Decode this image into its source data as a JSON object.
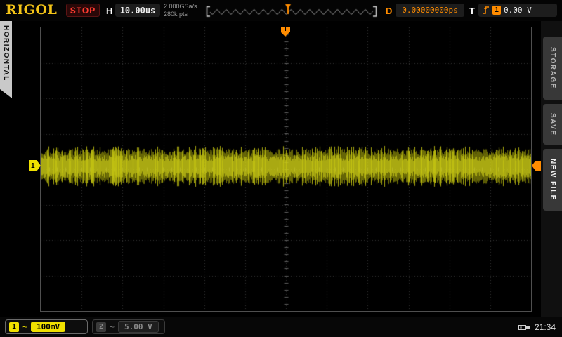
{
  "brand": "RIGOL",
  "status": "STOP",
  "colors": {
    "brand_yellow": "#f5c518",
    "ch1_yellow": "#f0e000",
    "trigger_orange": "#ff8c00",
    "stop_red": "#ff3b30",
    "grid_gray": "#343434",
    "trace_yellow": "#d8d800"
  },
  "horizontal": {
    "label": "H",
    "timebase": "10.00us",
    "sample_rate": "2.000GSa/s",
    "memory_depth": "280k pts"
  },
  "delay": {
    "label": "D",
    "value": "0.00000000ps"
  },
  "trigger": {
    "label": "T",
    "source": "1",
    "level": "0.00 V",
    "slope": "rising"
  },
  "left_tab": {
    "label": "HORIZONTAL"
  },
  "right_menu": {
    "items": [
      {
        "label": "STORAGE"
      },
      {
        "label": "SAVE"
      },
      {
        "label": "NEW FILE"
      }
    ]
  },
  "channels": [
    {
      "id": "1",
      "coupling_icon": "~",
      "scale": "100mV",
      "enabled": true
    },
    {
      "id": "2",
      "coupling_icon": "~",
      "scale": "5.00 V",
      "enabled": false
    }
  ],
  "markers": {
    "trigger_position_label": "T",
    "channel1_label": "1"
  },
  "statusbar": {
    "clock": "21:34"
  },
  "chart_data": {
    "type": "line",
    "instrument": "oscilloscope",
    "horizontal_divisions": 12,
    "vertical_divisions": 8,
    "timebase_per_division": "10.00us",
    "sample_rate": "2.000GSa/s",
    "memory_depth": "280k pts",
    "trigger_delay": "0.00000000ps",
    "trigger_level": "0.00 V",
    "grid": "dotted",
    "series": [
      {
        "name": "CH1",
        "volts_per_division": "100mV",
        "description": "dense flat noise band spanning all 12 horizontal divisions",
        "peak_to_peak_divisions": 1.0,
        "center_offset_divisions": 0.08,
        "color": "#d8d800"
      }
    ]
  }
}
